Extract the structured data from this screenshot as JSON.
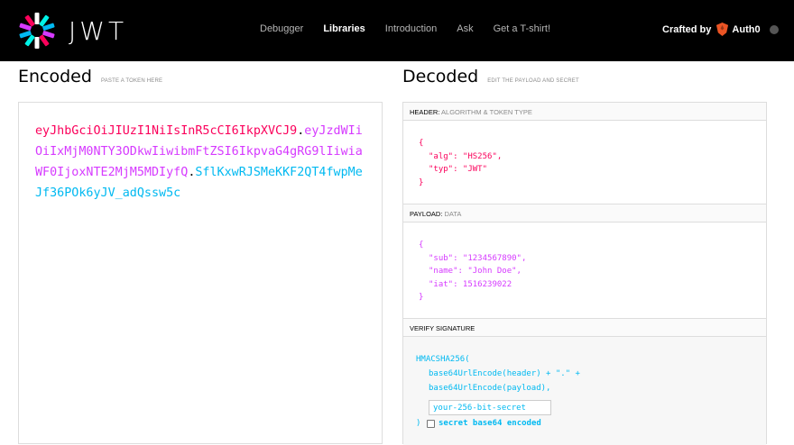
{
  "brand": {
    "wordmark": "JWT"
  },
  "nav": {
    "items": [
      {
        "label": "Debugger"
      },
      {
        "label": "Libraries"
      },
      {
        "label": "Introduction"
      },
      {
        "label": "Ask"
      },
      {
        "label": "Get a T-shirt!"
      }
    ],
    "active": "Libraries"
  },
  "crafted": {
    "label": "Crafted by",
    "brand": "Auth0"
  },
  "encoded": {
    "title": "Encoded",
    "subtitle": "PASTE A TOKEN HERE",
    "token_header": "eyJhbGciOiJIUzI1NiIsInR5cCI6IkpXVCJ9",
    "token_payload": "eyJzdWIiOiIxMjM0NTY3ODkwIiwibmFtZSI6IkpvaG4gRG9lIiwiaWF0IjoxNTE2MjM5MDIyfQ",
    "token_signature": "SflKxwRJSMeKKF2QT4fwpMeJf36POk6yJV_adQssw5c",
    "dot": "."
  },
  "decoded": {
    "title": "Decoded",
    "subtitle": "EDIT THE PAYLOAD AND SECRET",
    "header_section": {
      "label": "HEADER:",
      "muted": "ALGORITHM & TOKEN TYPE"
    },
    "header_json": {
      "open": "{",
      "lines": [
        "\"alg\": \"HS256\",",
        "\"typ\": \"JWT\""
      ],
      "close": "}"
    },
    "payload_section": {
      "label": "PAYLOAD:",
      "muted": "DATA"
    },
    "payload_json": {
      "open": "{",
      "lines": [
        "\"sub\": \"1234567890\",",
        "\"name\": \"John Doe\",",
        "\"iat\": 1516239022"
      ],
      "close": "}"
    },
    "verify_section": {
      "label": "VERIFY SIGNATURE"
    },
    "verify": {
      "line1": "HMACSHA256(",
      "line2": "base64UrlEncode(header) + \".\" +",
      "line3": "base64UrlEncode(payload),",
      "secret_placeholder": "your-256-bit-secret",
      "close": ")",
      "checkbox_label": "secret base64 encoded"
    }
  },
  "colors": {
    "header": "#fb015b",
    "payload": "#d63aff",
    "signature": "#00b9f1"
  }
}
